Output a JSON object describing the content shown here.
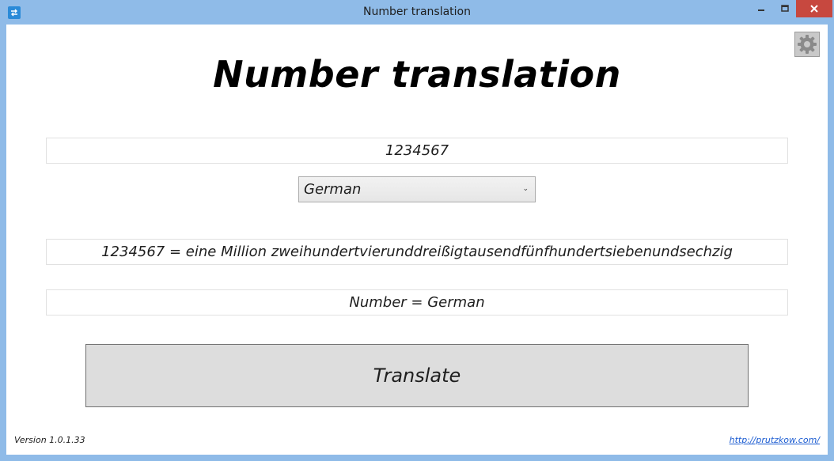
{
  "window": {
    "title": "Number translation",
    "icon": "app-swap-icon"
  },
  "controls": {
    "minimize_icon": "minimize-icon",
    "maximize_icon": "maximize-icon",
    "close_icon": "close-icon"
  },
  "settings": {
    "icon": "gear-icon"
  },
  "main": {
    "heading": "Number translation",
    "number_input": "1234567",
    "language": {
      "selected": "German",
      "icon": "chevron-down-icon"
    },
    "result": "1234567 = eine Million zweihundertvierunddreißigtausendfünfhundertsiebenundsechzig",
    "mode": "Number = German",
    "translate_label": "Translate"
  },
  "footer": {
    "version": "Version 1.0.1.33",
    "link": "http://prutzkow.com/"
  },
  "colors": {
    "frame": "#8fbbe8",
    "close_button": "#c7483f",
    "button_face": "#dddddd",
    "link": "#1a5bd1"
  }
}
